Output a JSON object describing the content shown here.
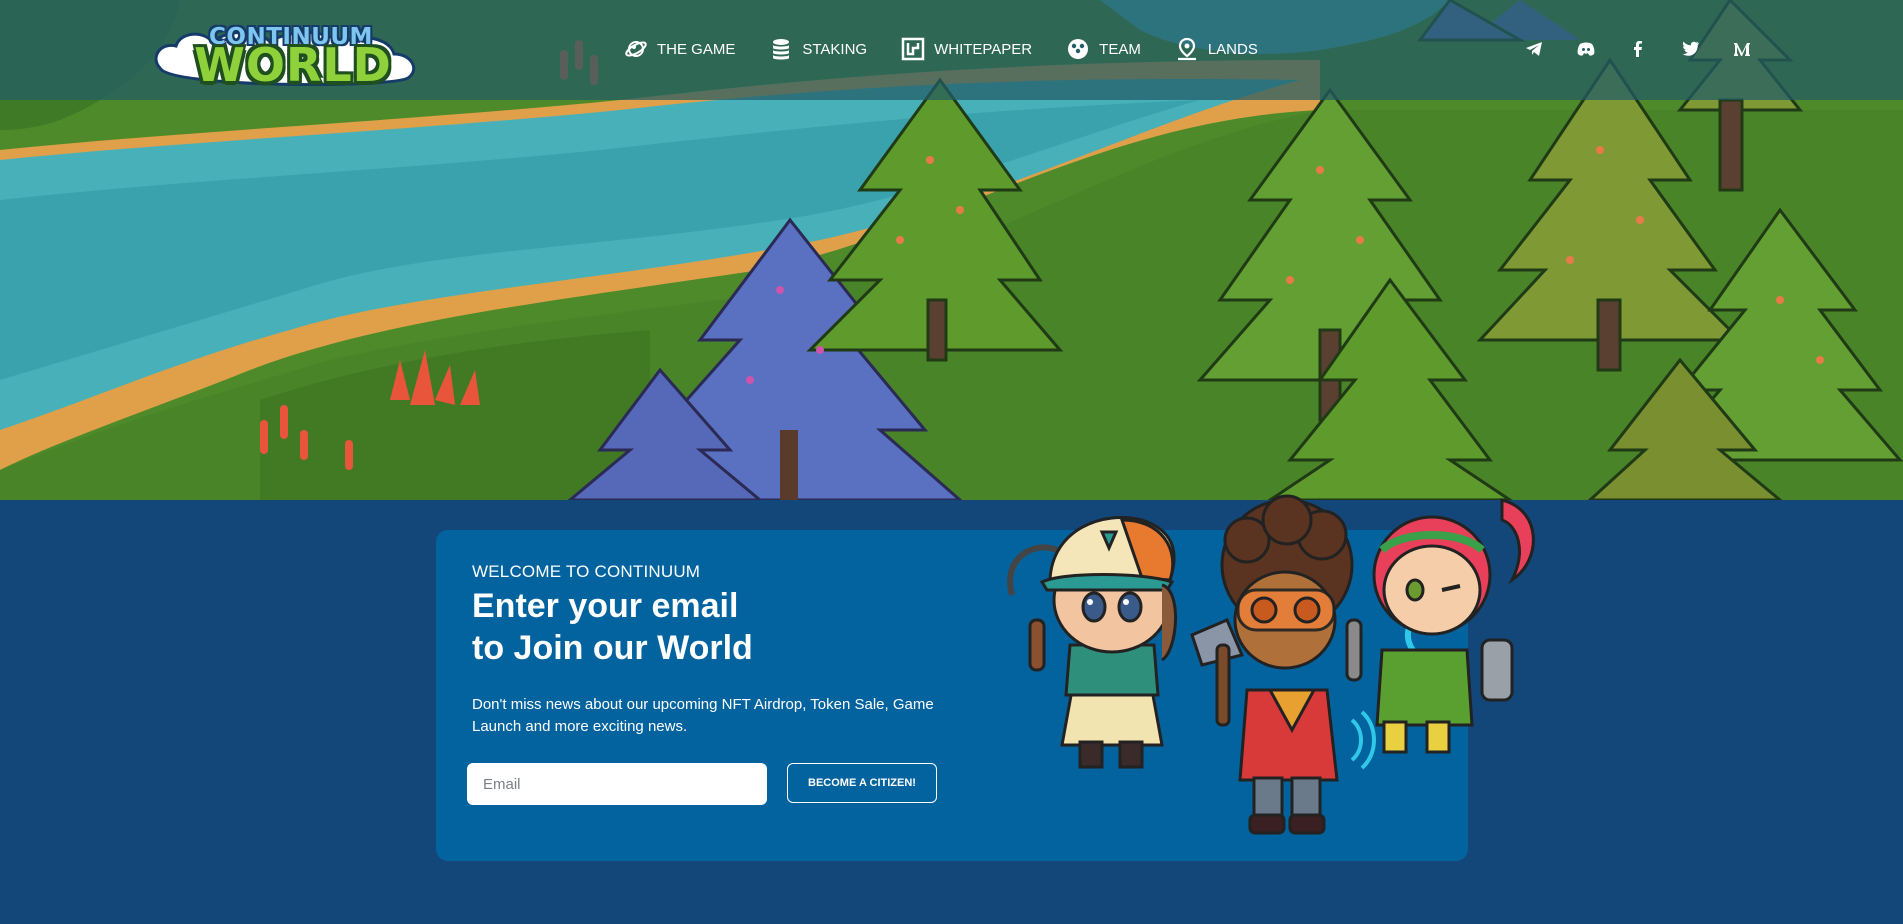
{
  "brand": {
    "logo_top": "CONTINUUM",
    "logo_bottom": "WORLD"
  },
  "nav": {
    "items": [
      {
        "label": "THE GAME",
        "icon": "game-planet-icon"
      },
      {
        "label": "STAKING",
        "icon": "coin-stack-icon"
      },
      {
        "label": "WHITEPAPER",
        "icon": "map-document-icon"
      },
      {
        "label": "TEAM",
        "icon": "team-people-icon"
      },
      {
        "label": "LANDS",
        "icon": "location-pin-icon"
      }
    ]
  },
  "social": [
    "telegram-icon",
    "discord-icon",
    "facebook-icon",
    "twitter-icon",
    "medium-icon"
  ],
  "signup": {
    "kicker": "WELCOME TO CONTINUUM",
    "headline_line1": "Enter your email",
    "headline_line2": "to Join our World",
    "description": "Don't miss news about our upcoming NFT Airdrop, Token Sale, Game Launch and more exciting news.",
    "email_placeholder": "Email",
    "email_value": "",
    "cta_label": "BECOME A CITIZEN!"
  },
  "colors": {
    "page_background": "#13477a",
    "card_background": "#03639f",
    "header_overlay": "#235c67",
    "button_border": "#ffffff"
  }
}
